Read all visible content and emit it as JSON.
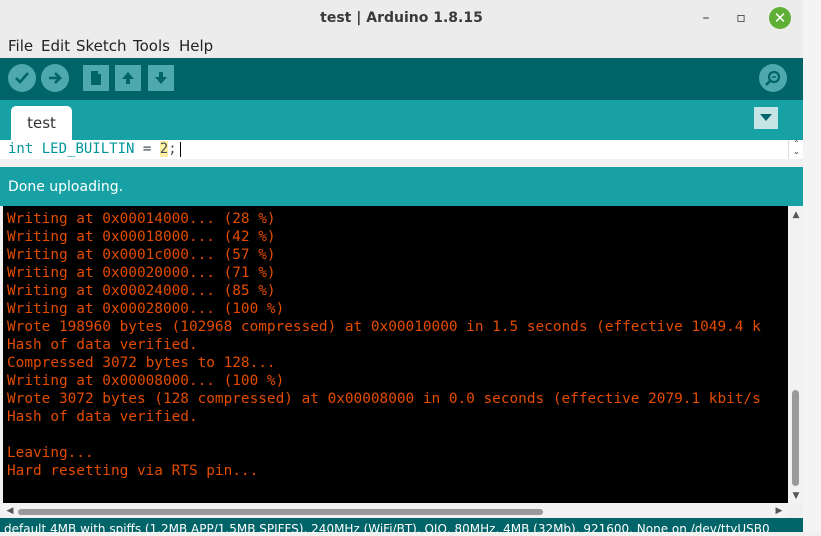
{
  "window": {
    "title": "test | Arduino 1.8.15",
    "minimize_label": "–",
    "restore_label": "▫",
    "close_label": "✕"
  },
  "menu": [
    "File",
    "Edit",
    "Sketch",
    "Tools",
    "Help"
  ],
  "toolbar": {
    "buttons": [
      "verify-icon",
      "upload-icon",
      "new-icon",
      "open-icon",
      "save-icon",
      "serial-monitor-icon"
    ]
  },
  "tabs": [
    {
      "label": "test"
    }
  ],
  "editor": {
    "keyword": "int",
    "identifier": "LED_BUILTIN",
    "operator": "=",
    "number": "2",
    "terminator": ";"
  },
  "status": {
    "text": "Done uploading."
  },
  "console": {
    "lines": [
      "Writing at 0x00014000... (28 %)",
      "Writing at 0x00018000... (42 %)",
      "Writing at 0x0001c000... (57 %)",
      "Writing at 0x00020000... (71 %)",
      "Writing at 0x00024000... (85 %)",
      "Writing at 0x00028000... (100 %)",
      "Wrote 198960 bytes (102968 compressed) at 0x00010000 in 1.5 seconds (effective 1049.4 k",
      "Hash of data verified.",
      "Compressed 3072 bytes to 128...",
      "Writing at 0x00008000... (100 %)",
      "Wrote 3072 bytes (128 compressed) at 0x00008000 in 0.0 seconds (effective 2079.1 kbit/s",
      "Hash of data verified.",
      "",
      "Leaving...",
      "Hard resetting via RTS pin..."
    ]
  },
  "bottom_info": "default 4MB with spiffs (1.2MB APP/1.5MB SPIFFS), 240MHz (WiFi/BT), QIO, 80MHz, 4MB (32Mb), 921600, None on /dev/ttyUSB0",
  "colors": {
    "toolbar": "#006468",
    "tabstrip": "#17a1a5",
    "console_text": "#e34c00",
    "close_button": "#5db035"
  }
}
